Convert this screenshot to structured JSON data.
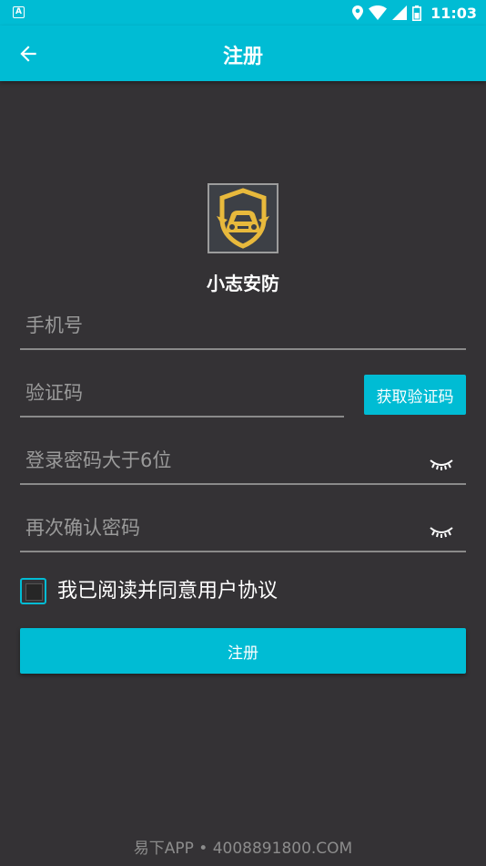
{
  "status_bar": {
    "notification_icon": "A",
    "time": "11:03",
    "icons": [
      "location-icon",
      "wifi-icon",
      "signal-icon",
      "battery-icon"
    ]
  },
  "appbar": {
    "title": "注册",
    "back_icon": "arrow-left-icon"
  },
  "app": {
    "name": "小志安防",
    "logo_icon": "shield-car-logo"
  },
  "form": {
    "phone_placeholder": "手机号",
    "code_placeholder": "验证码",
    "get_code_label": "获取验证码",
    "password_placeholder": "登录密码大于6位",
    "confirm_placeholder": "再次确认密码",
    "agreement_label": "我已阅读并同意用户协议",
    "agreement_checked": false,
    "submit_label": "注册"
  },
  "footer": {
    "watermark": "易下APP • 4008891800.COM"
  },
  "colors": {
    "accent": "#00bcd4",
    "background": "#343235",
    "logo_gold": "#e8b93c"
  }
}
